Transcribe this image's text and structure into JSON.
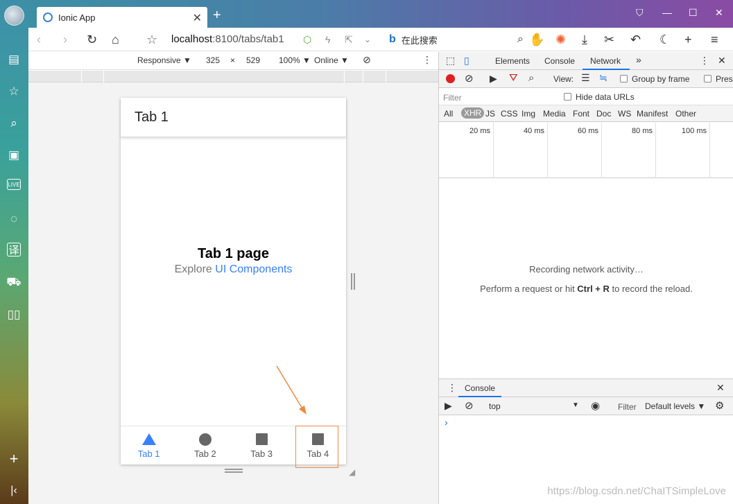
{
  "browser": {
    "tab_title": "Ionic App",
    "url_host": "localhost",
    "url_rest": ":8100/tabs/tab1",
    "search_placeholder": "在此搜索"
  },
  "device_toolbar": {
    "mode": "Responsive ▼",
    "width": "325",
    "times": "×",
    "height": "529",
    "zoom": "100% ▼",
    "network": "Online ▼"
  },
  "app": {
    "header_title": "Tab 1",
    "page_heading": "Tab 1 page",
    "explore_prefix": "Explore ",
    "explore_link": "UI Components",
    "tabs": [
      {
        "label": "Tab 1"
      },
      {
        "label": "Tab 2"
      },
      {
        "label": "Tab 3"
      },
      {
        "label": "Tab 4"
      }
    ]
  },
  "devtools": {
    "tabs": [
      "Elements",
      "Console",
      "Network"
    ],
    "view_label": "View:",
    "group_by_frame": "Group by frame",
    "preserve": "Pres",
    "filter_placeholder": "Filter",
    "hide_data_urls": "Hide data URLs",
    "types": [
      "All",
      "XHR",
      "JS",
      "CSS",
      "Img",
      "Media",
      "Font",
      "Doc",
      "WS",
      "Manifest",
      "Other"
    ],
    "timeline": [
      "20 ms",
      "40 ms",
      "60 ms",
      "80 ms",
      "100 ms"
    ],
    "recording_msg": "Recording network activity…",
    "perform_prefix": "Perform a request or hit ",
    "perform_keys": "Ctrl + R",
    "perform_suffix": " to record the reload.",
    "console_tab": "Console",
    "context": "top",
    "console_filter": "Filter",
    "levels": "Default levels ▼",
    "prompt": "›"
  },
  "watermark": "https://blog.csdn.net/ChaITSimpleLove",
  "colors": {
    "ionic_primary": "#3880ff",
    "highlight_orange": "#f08a3c",
    "devtools_active": "#1a73e8"
  }
}
